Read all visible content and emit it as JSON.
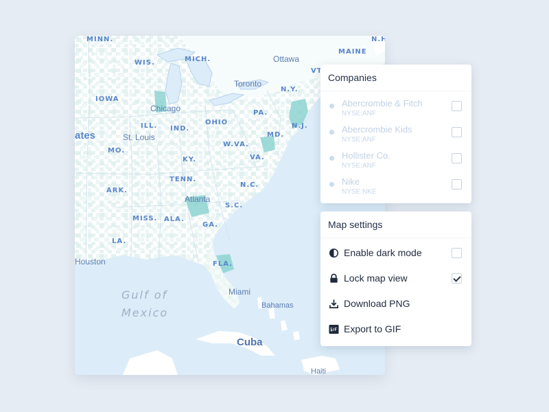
{
  "map": {
    "labels": {
      "minn": "MINN.",
      "wis": "WIS.",
      "mich": "MICH.",
      "iowa": "IOWA",
      "ill": "ILL.",
      "ind": "IND.",
      "ohio": "OHIO",
      "mo": "MO.",
      "ky": "KY.",
      "wva": "W.VA.",
      "va": "VA.",
      "tenn": "TENN.",
      "nc": "N.C.",
      "ark": "ARK.",
      "sc": "S.C.",
      "miss": "MISS.",
      "ala": "ALA.",
      "ga": "GA.",
      "la": "LA.",
      "fla": "FLA.",
      "pa": "PA.",
      "md": "MD.",
      "nj": "N.J.",
      "ny": "N.Y.",
      "vt": "VT",
      "maine": "MAINE",
      "nh": "N.H."
    },
    "cities": {
      "ottawa": "Ottawa",
      "toronto": "Toronto",
      "chicago": "Chicago",
      "st_louis": "St. Louis",
      "atlanta": "Atlanta",
      "houston": "Houston",
      "miami": "Miami",
      "bahamas": "Bahamas",
      "cuba": "Cuba",
      "haiti": "Haiti"
    },
    "gulf_line1": "Gulf of",
    "gulf_line2": "Mexico",
    "states_edge": "ates"
  },
  "companies_panel": {
    "title": "Companies",
    "items": [
      {
        "name": "Abercrombie & Fitch",
        "ticker": "NYSE:ANF",
        "checked": false
      },
      {
        "name": "Abercrombie Kids",
        "ticker": "NYSE:ANF",
        "checked": false
      },
      {
        "name": "Hollister Co.",
        "ticker": "NYSE:ANF",
        "checked": false
      },
      {
        "name": "Nike",
        "ticker": "NYSE:NKE",
        "checked": false
      }
    ]
  },
  "settings_panel": {
    "title": "Map settings",
    "items": [
      {
        "label": "Enable dark mode",
        "icon": "contrast-icon",
        "has_checkbox": true,
        "checked": false
      },
      {
        "label": "Lock map view",
        "icon": "lock-icon",
        "has_checkbox": true,
        "checked": true
      },
      {
        "label": "Download PNG",
        "icon": "download-icon",
        "has_checkbox": false
      },
      {
        "label": "Export to GIF",
        "icon": "gif-icon",
        "has_checkbox": false
      }
    ]
  },
  "colors": {
    "background": "#e6ecf3",
    "water": "#dcecf8",
    "land": "#ffffff",
    "highlight": "#7fcfcf",
    "label": "#5a86c9"
  }
}
